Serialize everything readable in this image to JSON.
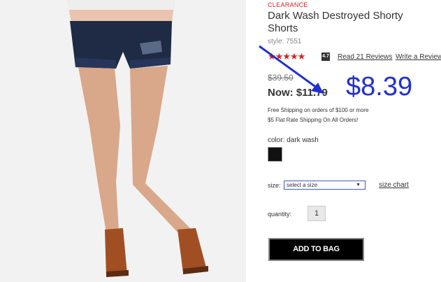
{
  "product": {
    "badge": "CLEARANCE",
    "title": "Dark Wash Destroyed Shorty Shorts",
    "style": "style: 7551",
    "rating_stars": "★★★★★",
    "rating_value": "4.7",
    "read_reviews": "Read 21 Reviews",
    "write_review": "Write a Review",
    "old_price": "$39.50",
    "now_price": "Now: $11.79",
    "annotation_price": "$8.39",
    "shipping_line1": "Free Shipping on orders of $100 or more",
    "shipping_line2": "$5 Flat Rate Shipping On All Orders!",
    "color_label": "color: dark wash",
    "size_label": "size:",
    "size_select_value": "select a size",
    "size_chart": "size chart",
    "quantity_label": "quantity:",
    "quantity_value": "1",
    "add_to_bag": "ADD TO BAG"
  },
  "colors": {
    "accent_red": "#dd2222",
    "annotation_blue": "#1f2fd6",
    "swatch": "#111111"
  },
  "icons": {
    "annotation": "arrow-icon",
    "dropdown": "caret-down-icon"
  }
}
